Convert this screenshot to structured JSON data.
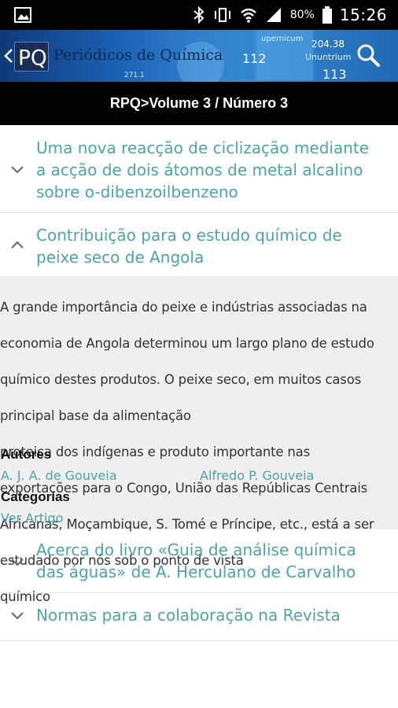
{
  "status_bar": {
    "battery_percent": "80%",
    "time": "15:26"
  },
  "app_bar": {
    "title": "Periódicos de Química",
    "logo_letters": "PQ"
  },
  "breadcrumb": "RPQ>Volume 3 / Número 3",
  "articles": [
    {
      "title": "Uma nova reacção de ciclização mediante a acção de dois átomos de metal alcalino sobre o-dibenzoilbenzeno",
      "lines": [
        "Uma nova reacção de ciclização mediante",
        "a acção de dois átomos de metal alcalino",
        "sobre o-dibenzoilbenzeno"
      ],
      "expanded": false
    },
    {
      "title": "Contribuição para o estudo químico de peixe seco de Angola",
      "lines": [
        "Contribuição para o estudo químico de",
        "peixe seco de Angola"
      ],
      "expanded": true,
      "abstract_lines": [
        "A grande importância do peixe e indústrias associadas na",
        "economia de Angola determinou um largo plano de estudo",
        "químico destes produtos. O peixe seco, em muitos casos",
        "principal base da alimentação",
        "proteica dos indígenas e produto importante nas",
        "exportações para o Congo, União das Repúblicas Centrais",
        "Africanas, Moçambique, S. Tomé e Príncipe, etc., está a ser",
        "estudado por nós sob o ponto de vista",
        "químico"
      ],
      "authors_label": "Autores",
      "authors": [
        "A. J. A. de Gouveia",
        "Alfredo P. Gouveia"
      ],
      "categories_label": "Categorias",
      "link_label": "Ver Artigo"
    },
    {
      "title": "Acerca do livro «Guia de análise química das águas» de A. Herculano de Carvalho",
      "lines": [
        "Acerca do livro «Guia de análise química",
        "das águas» de A. Herculano de Carvalho"
      ],
      "expanded": false
    },
    {
      "title": "Normas para a colaboração na Revista",
      "lines": [
        "Normas para a colaboração na Revista"
      ],
      "expanded": false
    }
  ],
  "banner_tiles": [
    "upernicum",
    "112",
    "204.38",
    "Ununtrium",
    "113",
    "271.1"
  ],
  "colors": {
    "accent_teal": "#4fa3a3",
    "bar_black": "#000000",
    "expanded_bg": "#efefef"
  },
  "icons": {
    "back": "chevron-left-icon",
    "search": "search-icon",
    "collapsed": "chevron-down-icon",
    "expanded": "chevron-up-icon"
  }
}
